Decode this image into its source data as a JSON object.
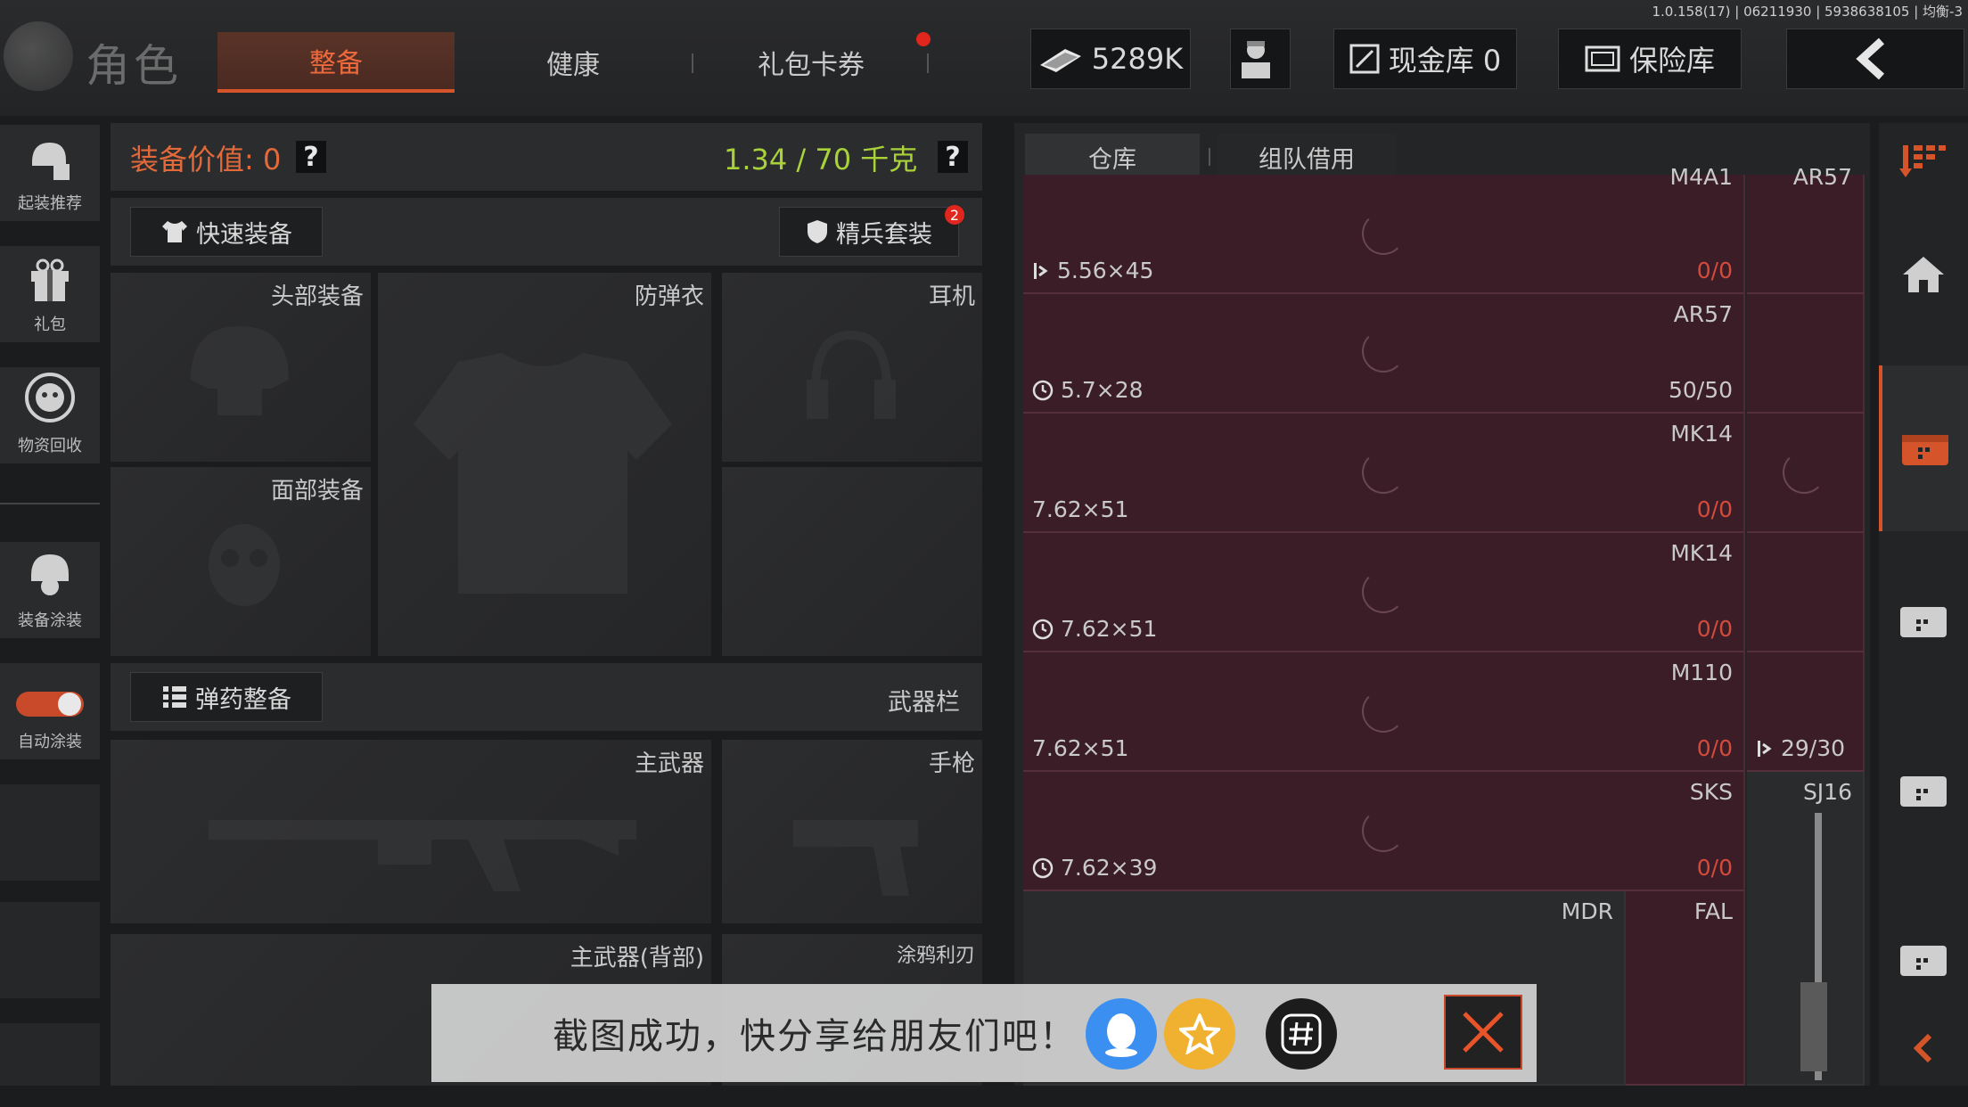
{
  "version": "1.0.158(17) | 06211930 | 5938638105 | 均衡-3",
  "header": {
    "title": "角色",
    "tabs": [
      {
        "label": "整备",
        "active": true
      },
      {
        "label": "健康",
        "active": false
      },
      {
        "label": "礼包卡券",
        "active": false
      }
    ],
    "money": "5289K",
    "cash_vault_label": "现金库 0",
    "safe_label": "保险库"
  },
  "sidebar": {
    "items": [
      {
        "label": "起装推荐",
        "icon": "helmet-gear-icon"
      },
      {
        "label": "礼包",
        "icon": "gift-icon"
      },
      {
        "label": "物资回收",
        "icon": "recycle-icon"
      },
      {
        "label": "装备涂装",
        "icon": "helmet-paint-icon"
      },
      {
        "label": "自动涂装",
        "icon": "toggle-icon",
        "toggle_on": true
      }
    ]
  },
  "loadout": {
    "equip_value_label": "装备价值: 0",
    "weight_label": "1.34 / 70 千克",
    "help": "?",
    "quick_equip": "快速装备",
    "elite_suit": "精兵套装",
    "elite_badge": "2",
    "slots": {
      "head": "头部装备",
      "armor": "防弹衣",
      "earphone": "耳机",
      "face": "面部装备",
      "primary": "主武器",
      "pistol": "手枪",
      "primary_back": "主武器(背部)",
      "graffiti_blade": "涂鸦利刃"
    },
    "ammo_button": "弹药整备",
    "weapon_bar": "武器栏"
  },
  "storage": {
    "tabs": [
      {
        "label": "仓库",
        "active": true
      },
      {
        "label": "组队借用",
        "active": false
      }
    ],
    "rows": [
      {
        "cells": [
          {
            "name": "M4A1",
            "caliber": "5.56×45",
            "count": "0/0",
            "icon": "export-icon"
          },
          {
            "name": "AR57",
            "caliber": "",
            "count": ""
          }
        ]
      },
      {
        "cells": [
          {
            "name": "AR57",
            "caliber": "5.7×28",
            "count": "50/50",
            "icon": "clock-icon"
          },
          {
            "name": "",
            "caliber": "",
            "count": ""
          }
        ]
      },
      {
        "cells": [
          {
            "name": "MK14",
            "caliber": "7.62×51",
            "count": "0/0",
            "icon": ""
          },
          {
            "name": "",
            "caliber": "",
            "count": ""
          }
        ]
      },
      {
        "cells": [
          {
            "name": "MK14",
            "caliber": "7.62×51",
            "count": "0/0",
            "icon": "clock-icon"
          },
          {
            "name": "",
            "caliber": "",
            "count": ""
          }
        ]
      },
      {
        "cells": [
          {
            "name": "M110",
            "caliber": "7.62×51",
            "count": "0/0",
            "icon": ""
          },
          {
            "name": "",
            "caliber": "29/30",
            "count": "",
            "icon": "export-icon"
          }
        ]
      },
      {
        "cells": [
          {
            "name": "SKS",
            "caliber": "7.62×39",
            "count": "0/0",
            "icon": "clock-icon"
          },
          {
            "name": "SJ16",
            "caliber": "",
            "count": ""
          }
        ]
      }
    ],
    "bottom_row": [
      "MDR",
      "FAL"
    ]
  },
  "toast": {
    "text": "截图成功，快分享给朋友们吧！"
  }
}
